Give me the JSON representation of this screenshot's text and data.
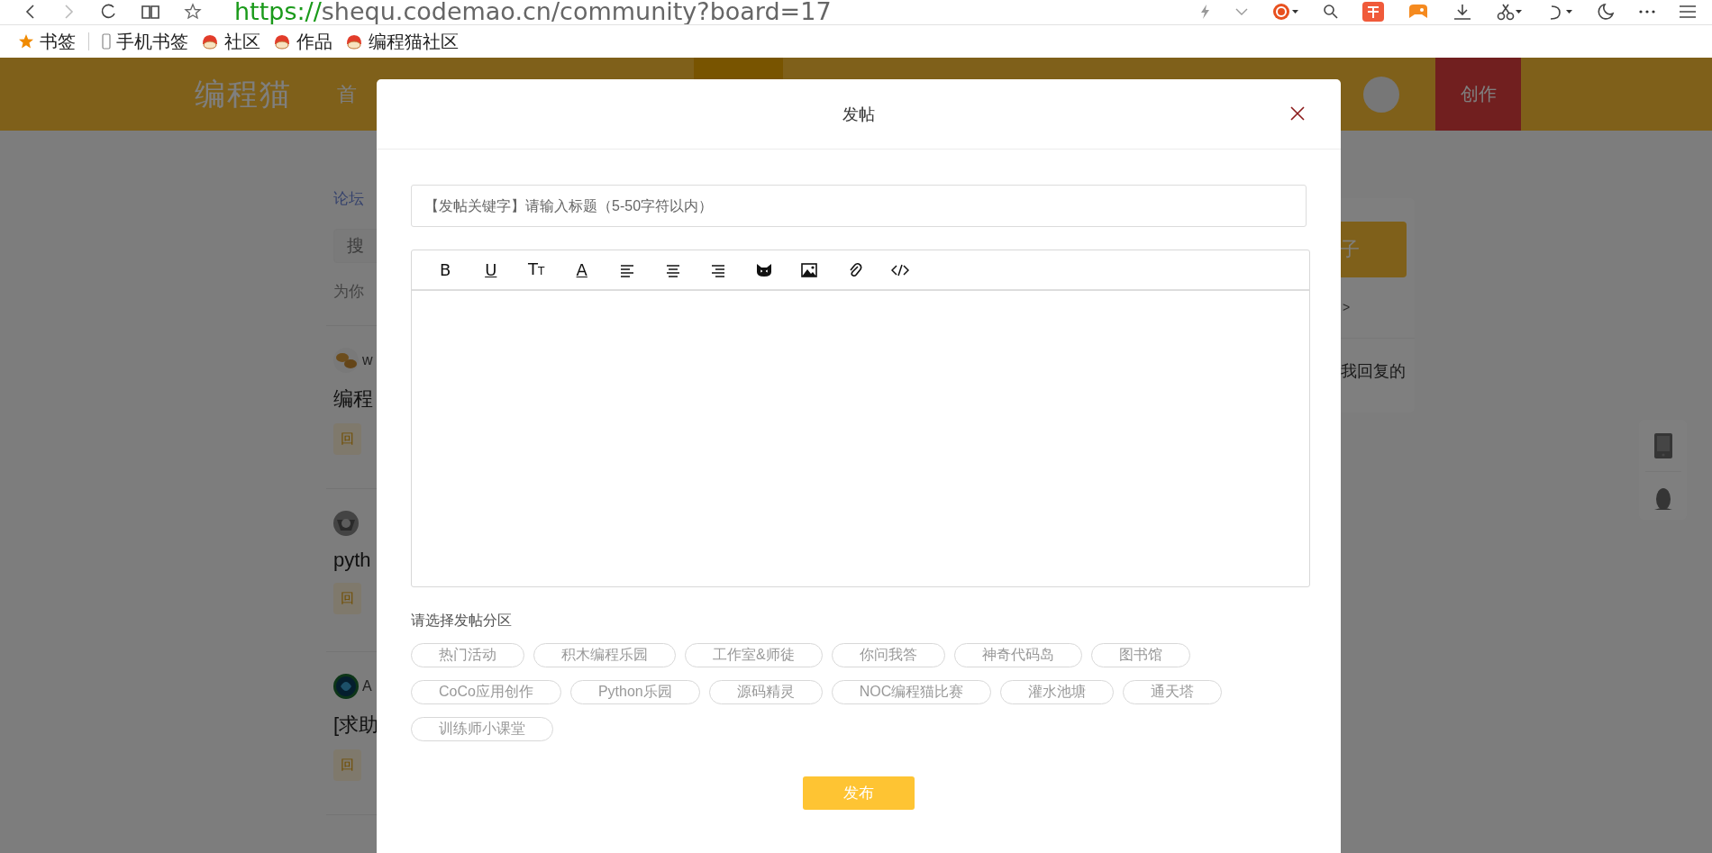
{
  "browser": {
    "address": "https://shequ.codemao.cn/community?board=17",
    "bookmarks": [
      {
        "label": "书签",
        "kind": "star"
      },
      {
        "label": "手机书签",
        "kind": "phone"
      },
      {
        "label": "社区",
        "kind": "site"
      },
      {
        "label": "作品",
        "kind": "site"
      },
      {
        "label": "编程猫社区",
        "kind": "site"
      }
    ]
  },
  "header": {
    "logo": "编程猫",
    "nav_item": "首",
    "create_button": "创作"
  },
  "left_column": {
    "breadcrumb": "论坛",
    "search_placeholder": "搜",
    "hint": "为你"
  },
  "posts": [
    {
      "author": "w",
      "title": "编程",
      "tag": "回"
    },
    {
      "title": "pyth",
      "tag": "回"
    },
    {
      "author": "A",
      "title": "[求助",
      "tag": "回"
    }
  ],
  "right_column": {
    "button": "子",
    "link": ">",
    "tab": "我回复的"
  },
  "modal": {
    "title": "发帖",
    "title_field": {
      "placeholder": "【发帖关键字】请输入标题（5-50字符以内）"
    },
    "toolbar": [
      {
        "kind": "letter",
        "glyph": "B"
      },
      {
        "kind": "underline",
        "glyph": "U"
      },
      {
        "kind": "size",
        "glyph": "TT"
      },
      {
        "kind": "underline",
        "glyph": "A"
      },
      {
        "kind": "align-left"
      },
      {
        "kind": "align-center"
      },
      {
        "kind": "align-right"
      },
      {
        "kind": "cat"
      },
      {
        "kind": "image"
      },
      {
        "kind": "clip"
      },
      {
        "kind": "code"
      }
    ],
    "section_label": "请选择发帖分区",
    "boards": [
      {
        "label": "热门活动",
        "selected": false
      },
      {
        "label": "积木编程乐园",
        "selected": false
      },
      {
        "label": "工作室&师徒",
        "selected": false
      },
      {
        "label": "你问我答",
        "selected": false
      },
      {
        "label": "神奇代码岛",
        "selected": false
      },
      {
        "label": "图书馆",
        "selected": false
      },
      {
        "label": "CoCo应用创作",
        "selected": false
      },
      {
        "label": "Python乐园",
        "selected": false
      },
      {
        "label": "源码精灵",
        "selected": false
      },
      {
        "label": "NOC编程猫比赛",
        "selected": false
      },
      {
        "label": "灌水池塘",
        "selected": false
      },
      {
        "label": "通天塔",
        "selected": false
      },
      {
        "label": "训练师小课堂",
        "selected": false
      }
    ],
    "submit": "发布"
  }
}
